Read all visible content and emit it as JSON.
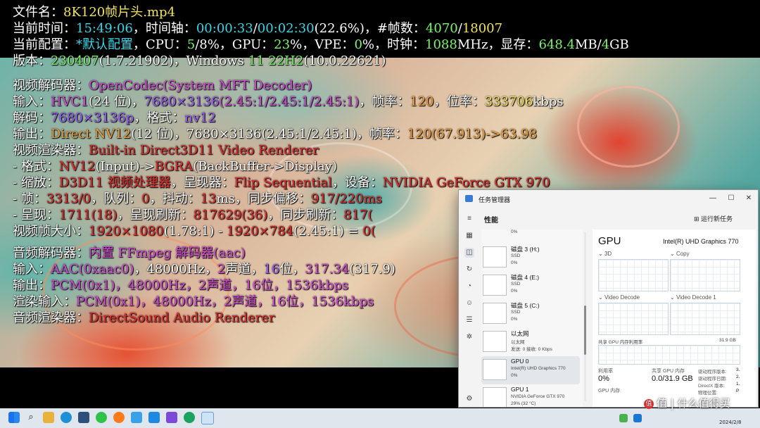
{
  "osd": {
    "file": {
      "label": "文件名：",
      "value": "8K120帧片头.mp4"
    },
    "time": {
      "label": "当前时间：",
      "clock": "15:49:06",
      "sep1": "，时间轴：",
      "pos": "00:00:33",
      "slash": "/",
      "dur": "00:02:30",
      "pct": "(22.6%)",
      "sep2": "，#帧数：",
      "frames": "4070",
      "slash2": "/",
      "total": "18007"
    },
    "config": {
      "label": "当前配置：",
      "preset": "*默认配置",
      "cpu_lbl": "，CPU：",
      "cpu": "5",
      "cpu_tot": "/8%",
      "gpu_lbl": "，GPU：",
      "gpu": "23",
      "gpu_pct": "%",
      "vpe_lbl": "，VPE：",
      "vpe": "0",
      "vpe_pct": "%",
      "clk_lbl": "，时钟：",
      "clk": "1088",
      "clk_unit": "MHz",
      "mem_lbl": "，显存：",
      "mem": "648.4",
      "mem_unit": "MB/",
      "mem_tot": "4",
      "mem_tot_unit": "GB"
    },
    "version": {
      "label": "版本：",
      "ver": "230407",
      "build": "(1.7.21902)",
      "os": "，Windows ",
      "osver": "11 22H2",
      "osbuild": "(10.0.22621)"
    },
    "vdec": {
      "label": "视频解码器：",
      "value": "OpenCodec(System MFT Decoder)"
    },
    "input": {
      "label": "输入：",
      "codec": "HVC1",
      "bits": "(24 位)",
      "sep": "，",
      "res": "7680×3136",
      "ratio": "(2.45:1/2.45:1/2.45:1)",
      "fps_lbl": "，帧率：",
      "fps": "120",
      "br_lbl": "，位率：",
      "br": "333706",
      "br_unit": "kbps"
    },
    "decode": {
      "label": "解码：",
      "res": "7680×3136p",
      "fmt_lbl": "，格式：",
      "fmt": "nv12"
    },
    "output": {
      "label": "输出：",
      "fmt": "Direct NV12",
      "bits": "(12 位)",
      "res": "，7680×3136(2.45:1/2.45:1)",
      "fps_lbl": "，帧率：",
      "fps": "120(67.913)->63.98"
    },
    "vrend": {
      "label": "视频渲染器：",
      "value": "Built-in Direct3D11 Video Renderer"
    },
    "vr_fmt": {
      "label": " - 格式：",
      "in": "NV12",
      "in_s": "(Input)->",
      "out": "BGRA",
      "out_s": "(BackBuffer->Display)"
    },
    "vr_scale": {
      "label": " - 缩放：",
      "value": "D3D11 视频处理器",
      "pres_lbl": "，呈现器：",
      "pres": "Flip Sequential",
      "dev_lbl": "，设备：",
      "dev": "NVIDIA GeForce GTX 970"
    },
    "vr_frame": {
      "label": " - 帧：",
      "frame": "3313/0",
      "q_lbl": "，队列：",
      "q": "0",
      "jit_lbl": "，抖动：",
      "jit": "13",
      "jit_unit": "ms",
      "off_lbl": "，同步偏移：",
      "off": "917/220ms"
    },
    "vr_present": {
      "label": " - 呈现：",
      "value": "1711(18)",
      "ref_lbl": "，呈现刷新：",
      "ref": "817629(36)",
      "sync_lbl": "，同步刷新：",
      "sync": "817("
    },
    "vsize": {
      "label": "视频帧大小：",
      "a": "1920×1080",
      "ar": "(1.78:1)",
      "sep": " - ",
      "b": "1920×784",
      "br": "(2.45:1)",
      "eq": " = ",
      "c": "0("
    },
    "adec": {
      "label": "音频解码器：",
      "value": "内置 FFmpeg 解码器(aac)"
    },
    "ainput": {
      "label": "输入：",
      "codec": "AAC(0xaac0)",
      "hz": "，48000Hz，",
      "ch": "2",
      "ch_s": "声道，",
      "bits": "16",
      "bits_s": "位，",
      "br": "317.34",
      "br2": "(317.9)"
    },
    "aoutput": {
      "label": "输出：",
      "value": "PCM(0x1)，48000Hz，2声道，16位，1536kbps"
    },
    "arin": {
      "label": "渲染输入：",
      "value": "PCM(0x1)，48000Hz，2声道，16位，1536kbps"
    },
    "arend": {
      "label": "音频渲染器：",
      "value": "DirectSound Audio Renderer"
    }
  },
  "taskmgr": {
    "title": "任务管理器",
    "section": "性能",
    "run_task": "运行新任务",
    "top_partial": "0%",
    "items": [
      {
        "name": "磁盘 3 (H:)",
        "type": "SSD",
        "value": "0%"
      },
      {
        "name": "磁盘 4 (E:)",
        "type": "SSD",
        "value": "0%"
      },
      {
        "name": "磁盘 5 (C:)",
        "type": "SSD",
        "value": "0%"
      },
      {
        "name": "以太网",
        "type": "以太网",
        "value": "发送: 0 接收: 0 Kbps"
      },
      {
        "name": "GPU 0",
        "type": "Intel(R) UHD Graphics 770",
        "value": "0%"
      },
      {
        "name": "GPU 1",
        "type": "NVIDIA GeForce GTX 970",
        "value": "29% (32 °C)"
      }
    ],
    "detail": {
      "title": "GPU",
      "name": "Intel(R) UHD Graphics 770",
      "g1": "3D",
      "g2": "Copy",
      "g3": "Video Decode",
      "g4": "Video Decode 1",
      "shared_lbl": "共享 GPU 内存利用率",
      "shared_max": "31.9 GB",
      "util_lbl": "利用率",
      "util": "0%",
      "shared_mem_lbl": "共享 GPU 内存",
      "shared_mem": "0.0/31.9 GB",
      "gpu_mem_lbl": "GPU 内存",
      "drv1_lbl": "驱动程序版本:",
      "drv1": "3.",
      "drv2_lbl": "驱动程序日期:",
      "drv2": "2.",
      "dx_lbl": "DirectX 版本:",
      "dx": "1.",
      "phys_lbl": "物理位置:",
      "phys": "P"
    }
  },
  "taskbar": {
    "date": "2024/2/8"
  },
  "watermark": "值 | 什么值得买"
}
